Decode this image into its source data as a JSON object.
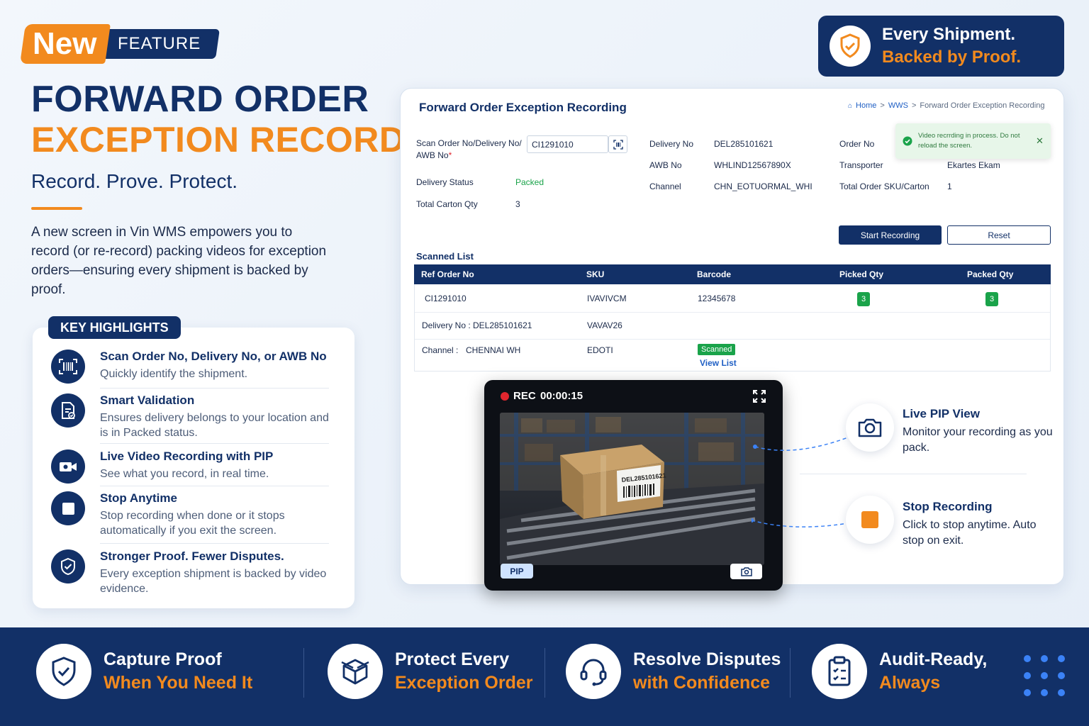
{
  "badge": {
    "new": "New",
    "feature": "FEATURE"
  },
  "hero": {
    "title_line1": "FORWARD ORDER",
    "title_line2": "EXCEPTION RECORDING",
    "tagline": "Record. Prove. Protect.",
    "description": "A new screen in Vin WMS empowers you to record (or re-record) packing videos for exception orders—ensuring every shipment is backed by proof."
  },
  "highlights": {
    "label": "KEY HIGHLIGHTS",
    "items": [
      {
        "icon": "barcode-scan-icon",
        "title": "Scan Order No, Delivery No, or AWB No",
        "sub": "Quickly identify the shipment."
      },
      {
        "icon": "document-check-icon",
        "title": "Smart Validation",
        "sub": "Ensures delivery belongs to your location and is in Packed status."
      },
      {
        "icon": "video-camera-icon",
        "title": "Live Video Recording with PIP",
        "sub": "See what you record, in real time."
      },
      {
        "icon": "stop-icon",
        "title": "Stop Anytime",
        "sub": "Stop recording when done or it stops automatically if you exit the screen."
      },
      {
        "icon": "shield-check-icon",
        "title": "Stronger Proof. Fewer Disputes.",
        "sub": "Every exception shipment is backed by video evidence."
      }
    ]
  },
  "proof_badge": {
    "line1": "Every Shipment.",
    "line2": "Backed by Proof."
  },
  "screen": {
    "title": "Forward Order Exception Recording",
    "breadcrumb": {
      "home": "Home",
      "sep1": ">",
      "wms": "WWS",
      "sep2": ">",
      "current": "Forward Order Exception Recording"
    },
    "scan_label": "Scan Order No/Delivery No/ AWB No",
    "scan_required": "*",
    "scan_value": "CI1291010",
    "fields": {
      "delivery_status_label": "Delivery Status",
      "delivery_status": "Packed",
      "total_carton_label": "Total Carton Qty",
      "total_carton": "3",
      "delivery_no_label": "Delivery No",
      "delivery_no": "DEL285101621",
      "awb_label": "AWB No",
      "awb": "WHLIND12567890X",
      "channel_label": "Channel",
      "channel": "CHN_EOTUORMAL_WHI",
      "order_no_label": "Order No",
      "transporter_label": "Transporter",
      "transporter": "Ekartes Ekam",
      "total_sku_label": "Total Order SKU/Carton",
      "total_sku": "1"
    },
    "toast": "Video recrrding in process. Do not reload the screen.",
    "start_button": "Start Recording",
    "reset_button": "Reset",
    "scanned_list_label": "Scanned List",
    "table": {
      "headers": [
        "Ref Order No",
        "SKU",
        "Barcode",
        "Picked Qty",
        "Packed Qty"
      ],
      "row1": {
        "ref": "CI1291010",
        "sku": "IVAVIVCM",
        "barcode": "12345678",
        "picked": "3",
        "packed": "3"
      },
      "row2": {
        "ref": "Delivery No : DEL285101621",
        "sku": "VAVAV26"
      },
      "row3": {
        "ref_label": "Channel :",
        "ref_value": "CHENNAI WH",
        "sku": "EDOTI",
        "status": "Scanned",
        "link": "View List"
      }
    }
  },
  "recorder": {
    "rec_label": "REC",
    "timer": "00:00:15",
    "box_label": "DEL285101621",
    "pip_label": "PIP"
  },
  "callouts": [
    {
      "icon": "camera-icon",
      "title": "Live PIP View",
      "sub": "Monitor your recording as you pack."
    },
    {
      "icon": "stop-square-icon",
      "title": "Stop Recording",
      "sub": "Click to stop anytime. Auto stop on exit."
    }
  ],
  "bottom": [
    {
      "icon": "shield-check-icon",
      "line1": "Capture Proof",
      "line2": "When You Need It"
    },
    {
      "icon": "package-icon",
      "line1": "Protect Every",
      "line2": "Exception Order"
    },
    {
      "icon": "headset-icon",
      "line1": "Resolve Disputes",
      "line2": "with Confidence"
    },
    {
      "icon": "clipboard-check-icon",
      "line1": "Audit-Ready,",
      "line2": "Always"
    }
  ],
  "colors": {
    "navy": "#123067",
    "orange": "#f28a1e",
    "green": "#1aa34a",
    "link": "#1f5fc4"
  }
}
